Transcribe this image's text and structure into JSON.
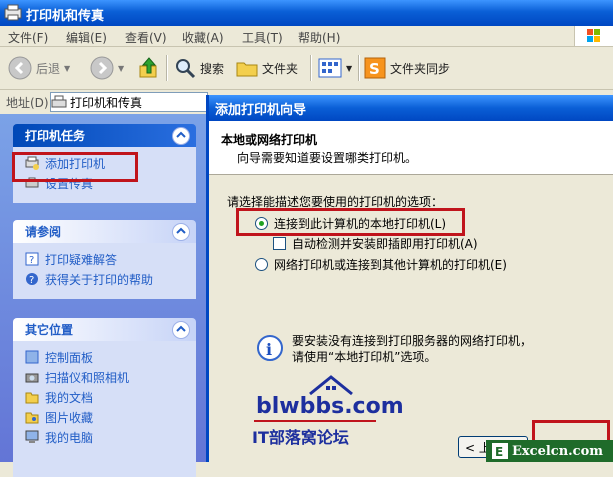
{
  "window": {
    "title": "打印机和传真"
  },
  "menu": [
    "文件(F)",
    "编辑(E)",
    "查看(V)",
    "收藏(A)",
    "工具(T)",
    "帮助(H)"
  ],
  "toolbar": {
    "back": "后退",
    "search": "搜索",
    "folders": "文件夹",
    "sync": "文件夹同步"
  },
  "address": {
    "label": "地址(D)",
    "value": "打印机和传真"
  },
  "left_pane": {
    "printer_tasks": {
      "title": "打印机任务",
      "items": [
        "添加打印机",
        "设置传真"
      ]
    },
    "see_also": {
      "title": "请参阅",
      "items": [
        "打印疑难解答",
        "获得关于打印的帮助"
      ]
    },
    "other_places": {
      "title": "其它位置",
      "items": [
        "控制面板",
        "扫描仪和照相机",
        "我的文档",
        "图片收藏",
        "我的电脑"
      ]
    }
  },
  "wizard": {
    "title": "添加打印机向导",
    "header_title": "本地或网络打印机",
    "header_subtitle": "向导需要知道要设置哪类打印机。",
    "prompt": "请选择能描述您要使用的打印机的选项：",
    "option_local": "连接到此计算机的本地打印机(L)",
    "option_autodetect": "自动检测并安装即插即用打印机(A)",
    "option_network": "网络打印机或连接到其他计算机的打印机(E)",
    "info_line1": "要安装没有连接到打印服务器的网络打印机，",
    "info_line2": "请使用“本地打印机”选项。",
    "back_button": "< 上"
  },
  "watermark": {
    "site": "blwbbs.com",
    "slogan": "IT部落窝论坛"
  },
  "badge": {
    "text": "Excelcn.com"
  }
}
